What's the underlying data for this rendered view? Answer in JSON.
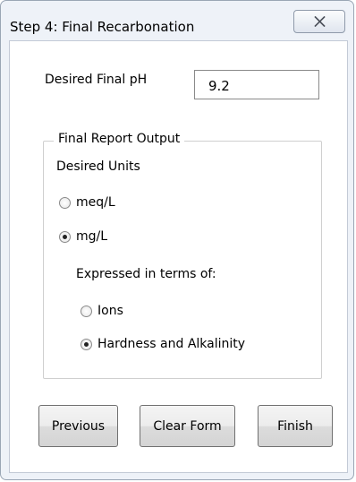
{
  "window": {
    "title": "Step 4: Final Recarbonation",
    "close_icon": "close-x-icon"
  },
  "ph": {
    "label": "Desired Final pH",
    "value": "9.2"
  },
  "report": {
    "group_title": "Final Report Output",
    "units_label": "Desired Units",
    "unit_options": [
      {
        "label": "meq/L",
        "selected": false
      },
      {
        "label": "mg/L",
        "selected": true
      }
    ],
    "expressed_label": "Expressed in terms of:",
    "expressed_options": [
      {
        "label": "Ions",
        "selected": false
      },
      {
        "label": "Hardness and Alkalinity",
        "selected": true
      }
    ]
  },
  "buttons": {
    "previous": "Previous",
    "clear": "Clear Form",
    "finish": "Finish"
  }
}
